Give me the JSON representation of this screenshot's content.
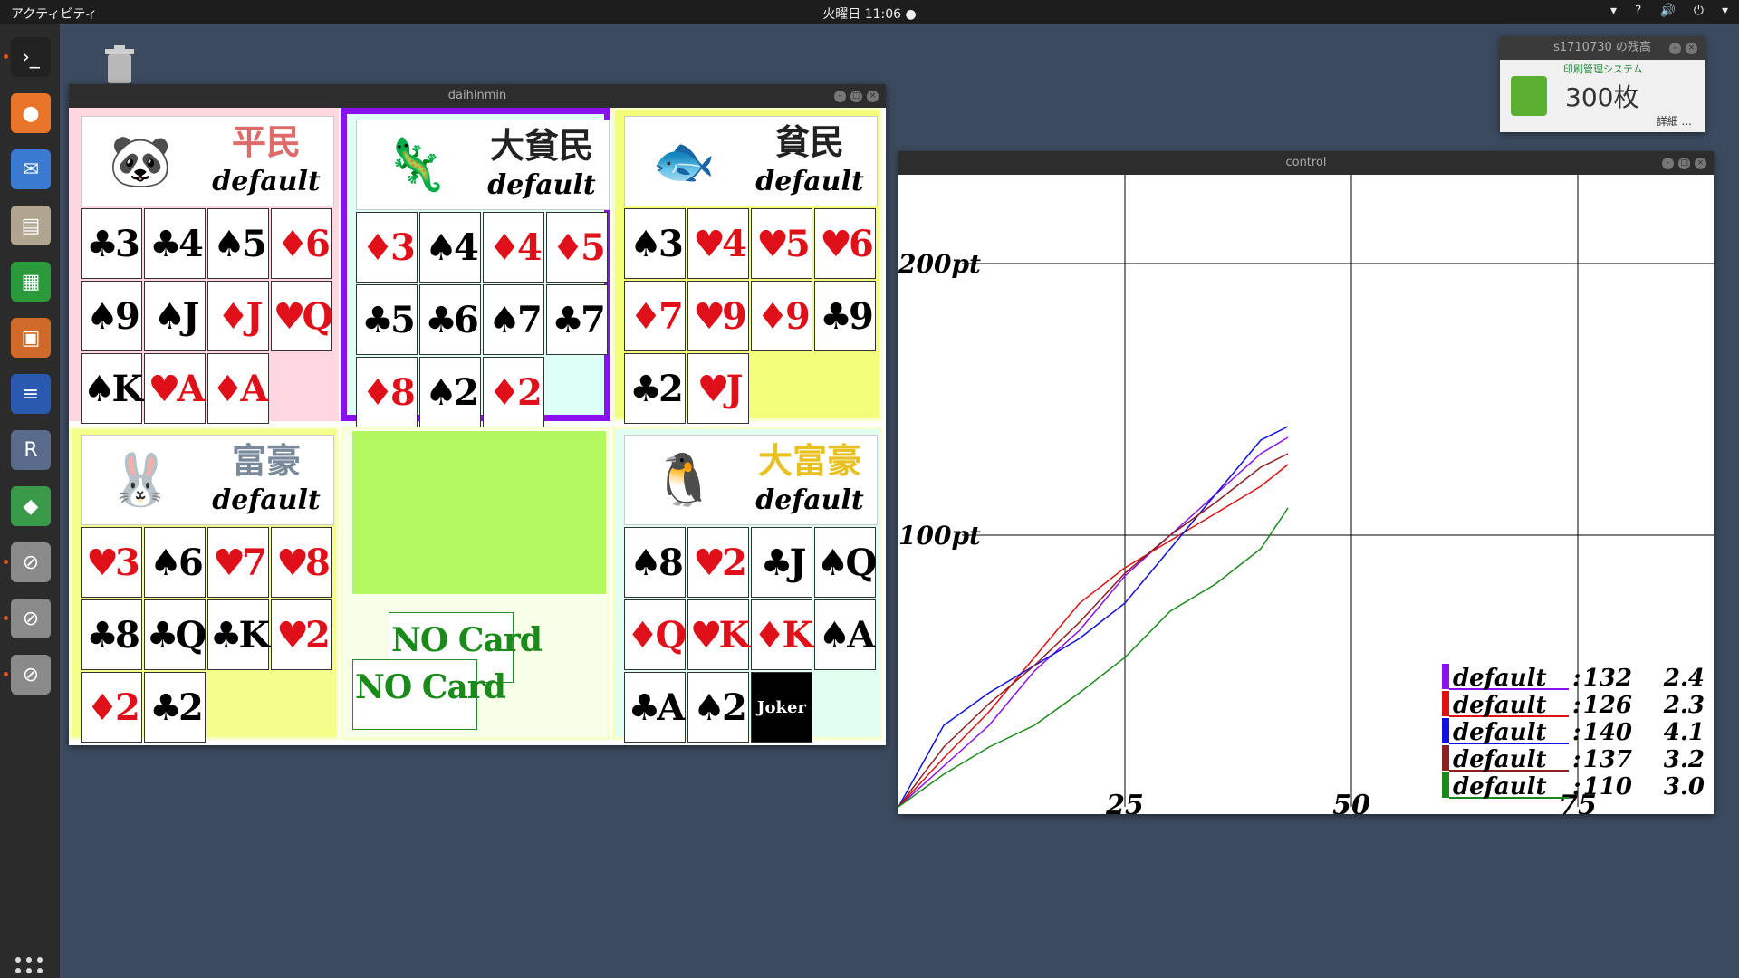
{
  "topbar": {
    "activities": "アクティビティ",
    "clock": "火曜日 11:06 ●",
    "tray": [
      "▾",
      "?",
      "🔊",
      "⏻",
      "▾"
    ]
  },
  "dock": {
    "icons": [
      "terminal-icon",
      "firefox-icon",
      "thunderbird-icon",
      "files-icon",
      "calc-icon",
      "impress-icon",
      "writer-icon",
      "r-icon",
      "app-icon",
      "blocked-icon",
      "blocked-icon",
      "blocked-icon"
    ]
  },
  "daihinmin": {
    "title": "daihinmin",
    "players": [
      {
        "rank": "平民",
        "name": "default",
        "rank_color": "#e06a6a",
        "bg": "#ffd7e0",
        "border": "#ffd7e0",
        "hl": "#ffc8d0",
        "cards": [
          [
            "♣3",
            "b"
          ],
          [
            "♣4",
            "b"
          ],
          [
            "♠5",
            "b"
          ],
          [
            "♦6",
            "r"
          ],
          [
            "♠9",
            "b"
          ],
          [
            "♠J",
            "b"
          ],
          [
            "♦J",
            "r"
          ],
          [
            "♥Q",
            "r"
          ],
          [
            "♠K",
            "b"
          ],
          [
            "♥A",
            "r"
          ],
          [
            "♦A",
            "r"
          ]
        ]
      },
      {
        "rank": "大貧民",
        "name": "default",
        "rank_color": "#222",
        "bg": "#ddfff5",
        "border": "#8a10f0",
        "hl": "#ddfff5",
        "cards": [
          [
            "♦3",
            "r"
          ],
          [
            "♠4",
            "b"
          ],
          [
            "♦4",
            "r"
          ],
          [
            "♦5",
            "r"
          ],
          [
            "♣5",
            "b"
          ],
          [
            "♣6",
            "b"
          ],
          [
            "♠7",
            "b"
          ],
          [
            "♣7",
            "b"
          ],
          [
            "♦8",
            "r"
          ],
          [
            "♠2",
            "b"
          ],
          [
            "♦2",
            "r"
          ]
        ]
      },
      {
        "rank": "貧民",
        "name": "default",
        "rank_color": "#222",
        "bg": "#f3ff7a",
        "border": "#f8ffc8",
        "hl": "#f2fa80",
        "cards": [
          [
            "♠3",
            "b"
          ],
          [
            "♥4",
            "r"
          ],
          [
            "♥5",
            "r"
          ],
          [
            "♥6",
            "r"
          ],
          [
            "♦7",
            "r"
          ],
          [
            "♥9",
            "r"
          ],
          [
            "♦9",
            "r"
          ],
          [
            "♣9",
            "b"
          ],
          [
            "♣2",
            "b"
          ],
          [
            "♥J",
            "r"
          ]
        ]
      },
      {
        "rank": "富豪",
        "name": "default",
        "rank_color": "#7a8a9a",
        "bg": "#f3ff8a",
        "border": "#f8ffc8",
        "hl": "#f0fa80",
        "cards": [
          [
            "♥3",
            "r"
          ],
          [
            "♠6",
            "b"
          ],
          [
            "♥7",
            "r"
          ],
          [
            "♥8",
            "r"
          ],
          [
            "♣8",
            "b"
          ],
          [
            "♣Q",
            "b"
          ],
          [
            "♣K",
            "b"
          ],
          [
            "♥2",
            "r"
          ],
          [
            "♦2",
            "r"
          ],
          [
            "♣2",
            "b"
          ]
        ]
      },
      {
        "rank": "大富豪",
        "name": "default",
        "rank_color": "#e8c020",
        "bg": "#e0fff0",
        "border": "#f8ffc8",
        "hl": "#ddfff0",
        "cards": [
          [
            "♠8",
            "b"
          ],
          [
            "♥2",
            "r"
          ],
          [
            "♣J",
            "b"
          ],
          [
            "♠Q",
            "b"
          ],
          [
            "♦Q",
            "r"
          ],
          [
            "♥K",
            "r"
          ],
          [
            "♦K",
            "r"
          ],
          [
            "♠A",
            "b"
          ],
          [
            "♣A",
            "b"
          ],
          [
            "♠2",
            "b"
          ],
          [
            "Joker",
            "j"
          ]
        ]
      }
    ],
    "field": {
      "top_color": "#b4f860",
      "nocard": [
        "NO Card",
        "NO Card"
      ]
    }
  },
  "control": {
    "title": "control",
    "chart_data": {
      "type": "line",
      "x_ticks": [
        "25",
        "50",
        "75"
      ],
      "y_ticks": [
        "100pt",
        "200pt"
      ],
      "x_range": [
        0,
        90
      ],
      "y_range": [
        0,
        200
      ],
      "grid": true,
      "legend_position": "bottom-right",
      "series": [
        {
          "name": "default",
          "color": "#8a10f0",
          "score": "132",
          "avg": "2.4",
          "x": [
            0,
            5,
            10,
            15,
            20,
            25,
            30,
            35,
            40,
            43
          ],
          "y": [
            0,
            15,
            30,
            50,
            65,
            85,
            100,
            115,
            130,
            136
          ]
        },
        {
          "name": "default",
          "color": "#e01010",
          "score": "126",
          "avg": "2.3",
          "x": [
            0,
            5,
            10,
            15,
            20,
            25,
            30,
            35,
            40,
            43
          ],
          "y": [
            0,
            18,
            35,
            55,
            75,
            88,
            98,
            108,
            118,
            126
          ]
        },
        {
          "name": "default",
          "color": "#1010e0",
          "score": "140",
          "avg": "4.1",
          "x": [
            0,
            5,
            10,
            15,
            20,
            25,
            30,
            35,
            40,
            43
          ],
          "y": [
            0,
            30,
            42,
            52,
            62,
            75,
            95,
            115,
            135,
            140
          ]
        },
        {
          "name": "default",
          "color": "#8a2020",
          "score": "137",
          "avg": "3.2",
          "x": [
            0,
            5,
            10,
            15,
            20,
            25,
            30,
            35,
            40,
            43
          ],
          "y": [
            0,
            22,
            38,
            52,
            68,
            86,
            100,
            112,
            125,
            130
          ]
        },
        {
          "name": "default",
          "color": "#1a8a1a",
          "score": "110",
          "avg": "3.0",
          "x": [
            0,
            5,
            10,
            15,
            20,
            25,
            30,
            35,
            40,
            43
          ],
          "y": [
            0,
            12,
            22,
            30,
            42,
            55,
            72,
            82,
            95,
            110
          ]
        }
      ]
    }
  },
  "printwidget": {
    "title": "s1710730 の残高",
    "system": "印刷管理システム",
    "count": "300枚",
    "more": "詳細 ..."
  }
}
